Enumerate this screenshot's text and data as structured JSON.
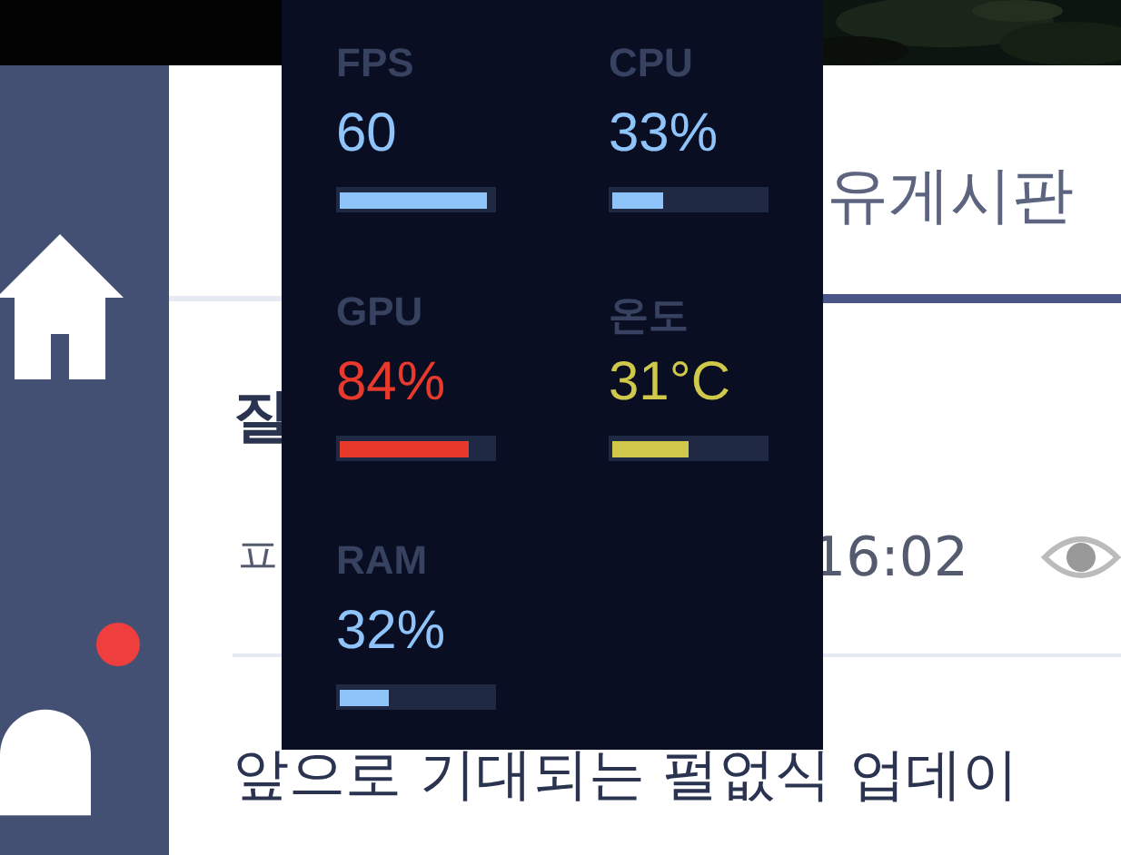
{
  "board": {
    "title": "유게시판"
  },
  "post": {
    "title": "질",
    "author": "ㅍ",
    "time": "16:02"
  },
  "next_post": {
    "title": "앞으로 기대되는 펄없식 업데이"
  },
  "overlay": {
    "stats": [
      {
        "label": "FPS",
        "value": "60",
        "level": 0.97,
        "color": "#8ec4fa"
      },
      {
        "label": "CPU",
        "value": "33%",
        "level": 0.33,
        "color": "#8ec4fa"
      },
      {
        "label": "GPU",
        "value": "84%",
        "level": 0.84,
        "color": "#e8392d"
      },
      {
        "label": "온도",
        "value": "31°C",
        "level": 0.5,
        "color": "#cfc84a"
      },
      {
        "label": "RAM",
        "value": "32%",
        "level": 0.32,
        "color": "#8ec4fa"
      }
    ]
  }
}
